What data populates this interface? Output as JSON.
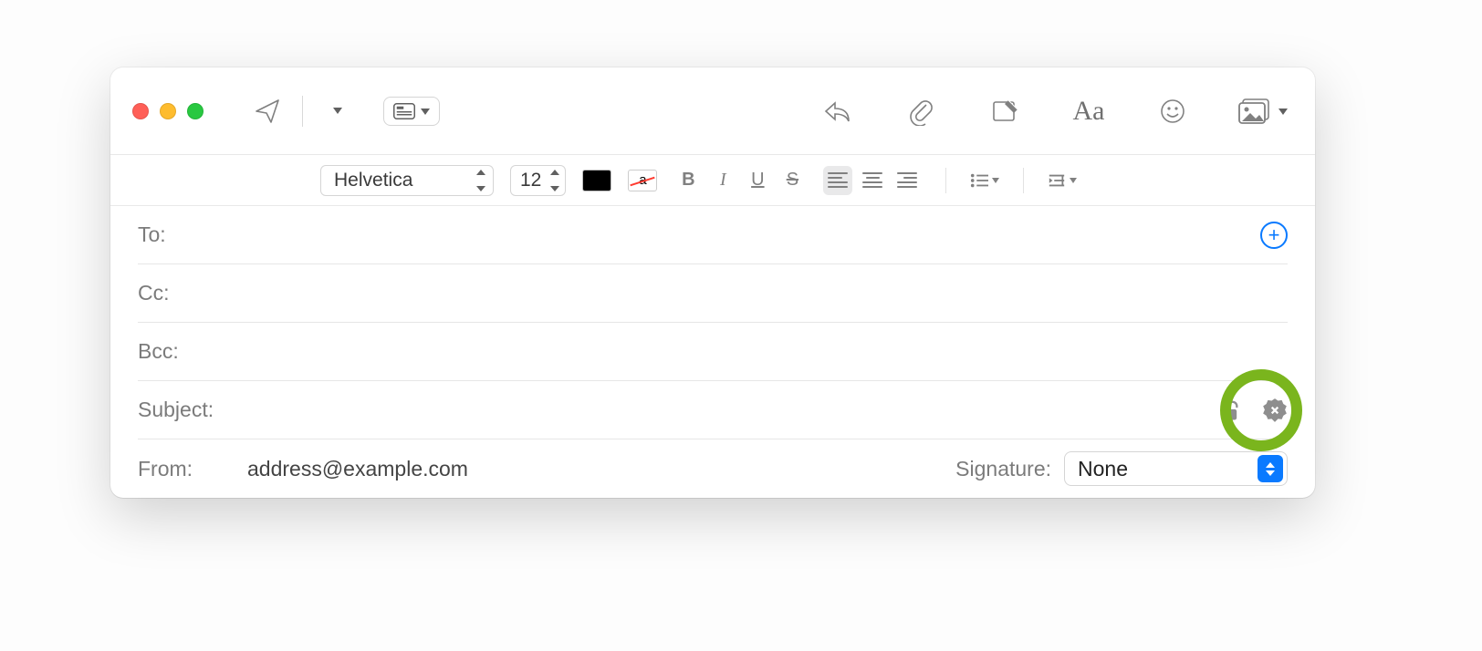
{
  "toolbar": {
    "send_name": "send",
    "header_dropdown_name": "header-fields"
  },
  "format": {
    "font_family": "Helvetica",
    "font_size": "12",
    "bold": "B",
    "italic": "I",
    "underline": "U",
    "strike": "S"
  },
  "headers": {
    "to_label": "To:",
    "cc_label": "Cc:",
    "bcc_label": "Bcc:",
    "subject_label": "Subject:",
    "from_label": "From:",
    "from_value": "address@example.com",
    "to_value": "",
    "cc_value": "",
    "bcc_value": "",
    "subject_value": ""
  },
  "signature": {
    "label": "Signature:",
    "value": "None"
  },
  "swatch_letter": "a"
}
